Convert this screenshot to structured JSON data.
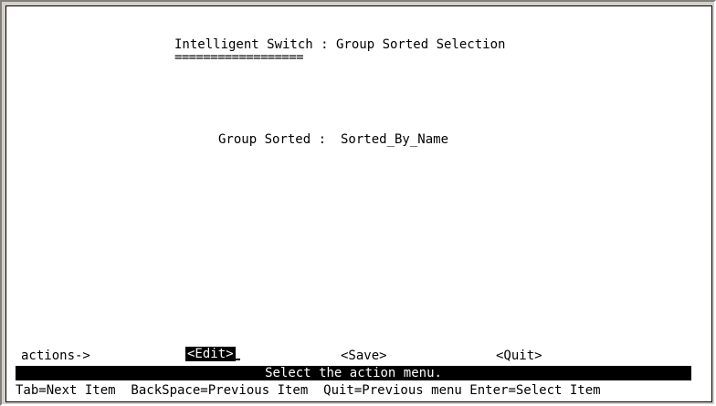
{
  "screen": {
    "title": "Intelligent Switch : Group Sorted Selection",
    "underline": "=================="
  },
  "field": {
    "label": "Group Sorted :",
    "value": "Sorted_By_Name"
  },
  "actions": {
    "prompt": "actions->",
    "edit_label": "<Edit>",
    "save_label": "<Save>",
    "quit_label": "<Quit>",
    "selected": "<Edit>"
  },
  "status_message": "Select the action menu.",
  "help_line": "Tab=Next Item  BackSpace=Previous Item  Quit=Previous menu Enter=Select Item",
  "colors": {
    "background": "#ffffff",
    "highlight": "#000000",
    "highlight_text": "#ffffff"
  }
}
